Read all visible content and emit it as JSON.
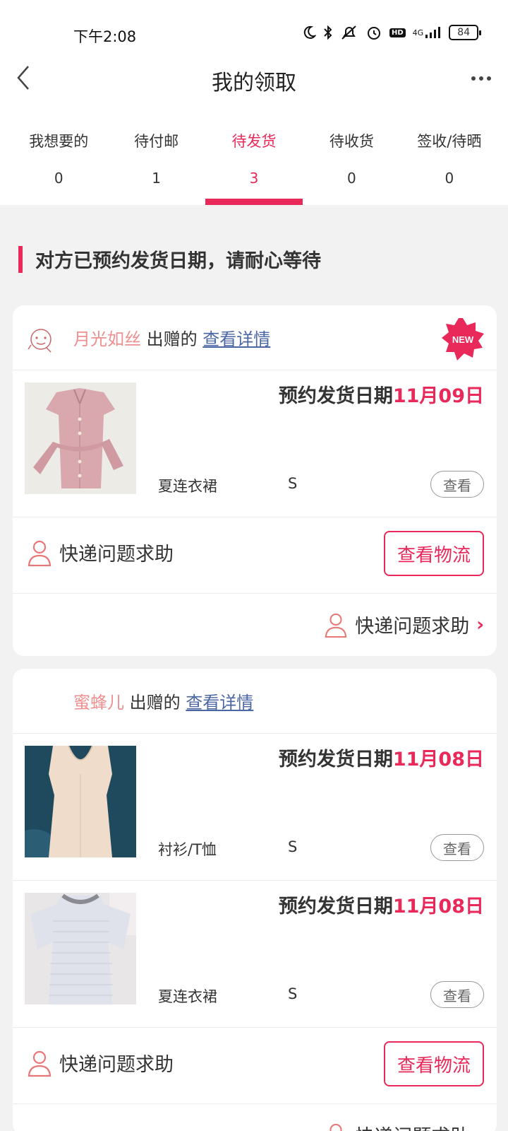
{
  "status_bar": {
    "time": "下午2:08",
    "network": "4G",
    "hd": "HD",
    "battery": "84"
  },
  "header": {
    "title": "我的领取"
  },
  "tabs": [
    {
      "label": "我想要的",
      "count": "0",
      "active": false
    },
    {
      "label": "待付邮",
      "count": "1",
      "active": false
    },
    {
      "label": "待发货",
      "count": "3",
      "active": true
    },
    {
      "label": "待收货",
      "count": "0",
      "active": false
    },
    {
      "label": "签收/待晒",
      "count": "0",
      "active": false
    }
  ],
  "notice": "对方已预约发货日期，请耐心等待",
  "cards": [
    {
      "giver": "月光如丝",
      "gave_text": "出赠的",
      "detail_link": "查看详情",
      "badge": "NEW",
      "items": [
        {
          "ship_label": "预约发货日期",
          "ship_date": "11月09日",
          "category": "夏连衣裙",
          "size": "S",
          "view": "查看"
        }
      ],
      "help_label": "快递问题求助",
      "logistics_label": "查看物流",
      "help_link": "快递问题求助"
    },
    {
      "giver": "蜜蜂儿",
      "gave_text": "出赠的",
      "detail_link": "查看详情",
      "items": [
        {
          "ship_label": "预约发货日期",
          "ship_date": "11月08日",
          "category": "衬衫/T恤",
          "size": "S",
          "view": "查看"
        },
        {
          "ship_label": "预约发货日期",
          "ship_date": "11月08日",
          "category": "夏连衣裙",
          "size": "S",
          "view": "查看"
        }
      ],
      "help_label": "快递问题求助",
      "logistics_label": "查看物流",
      "help_link": "快递问题求助"
    }
  ],
  "colors": {
    "accent": "#e8295a",
    "giver_name": "#ef8f8f",
    "link": "#4b67a3",
    "background": "#f2f2f2"
  }
}
